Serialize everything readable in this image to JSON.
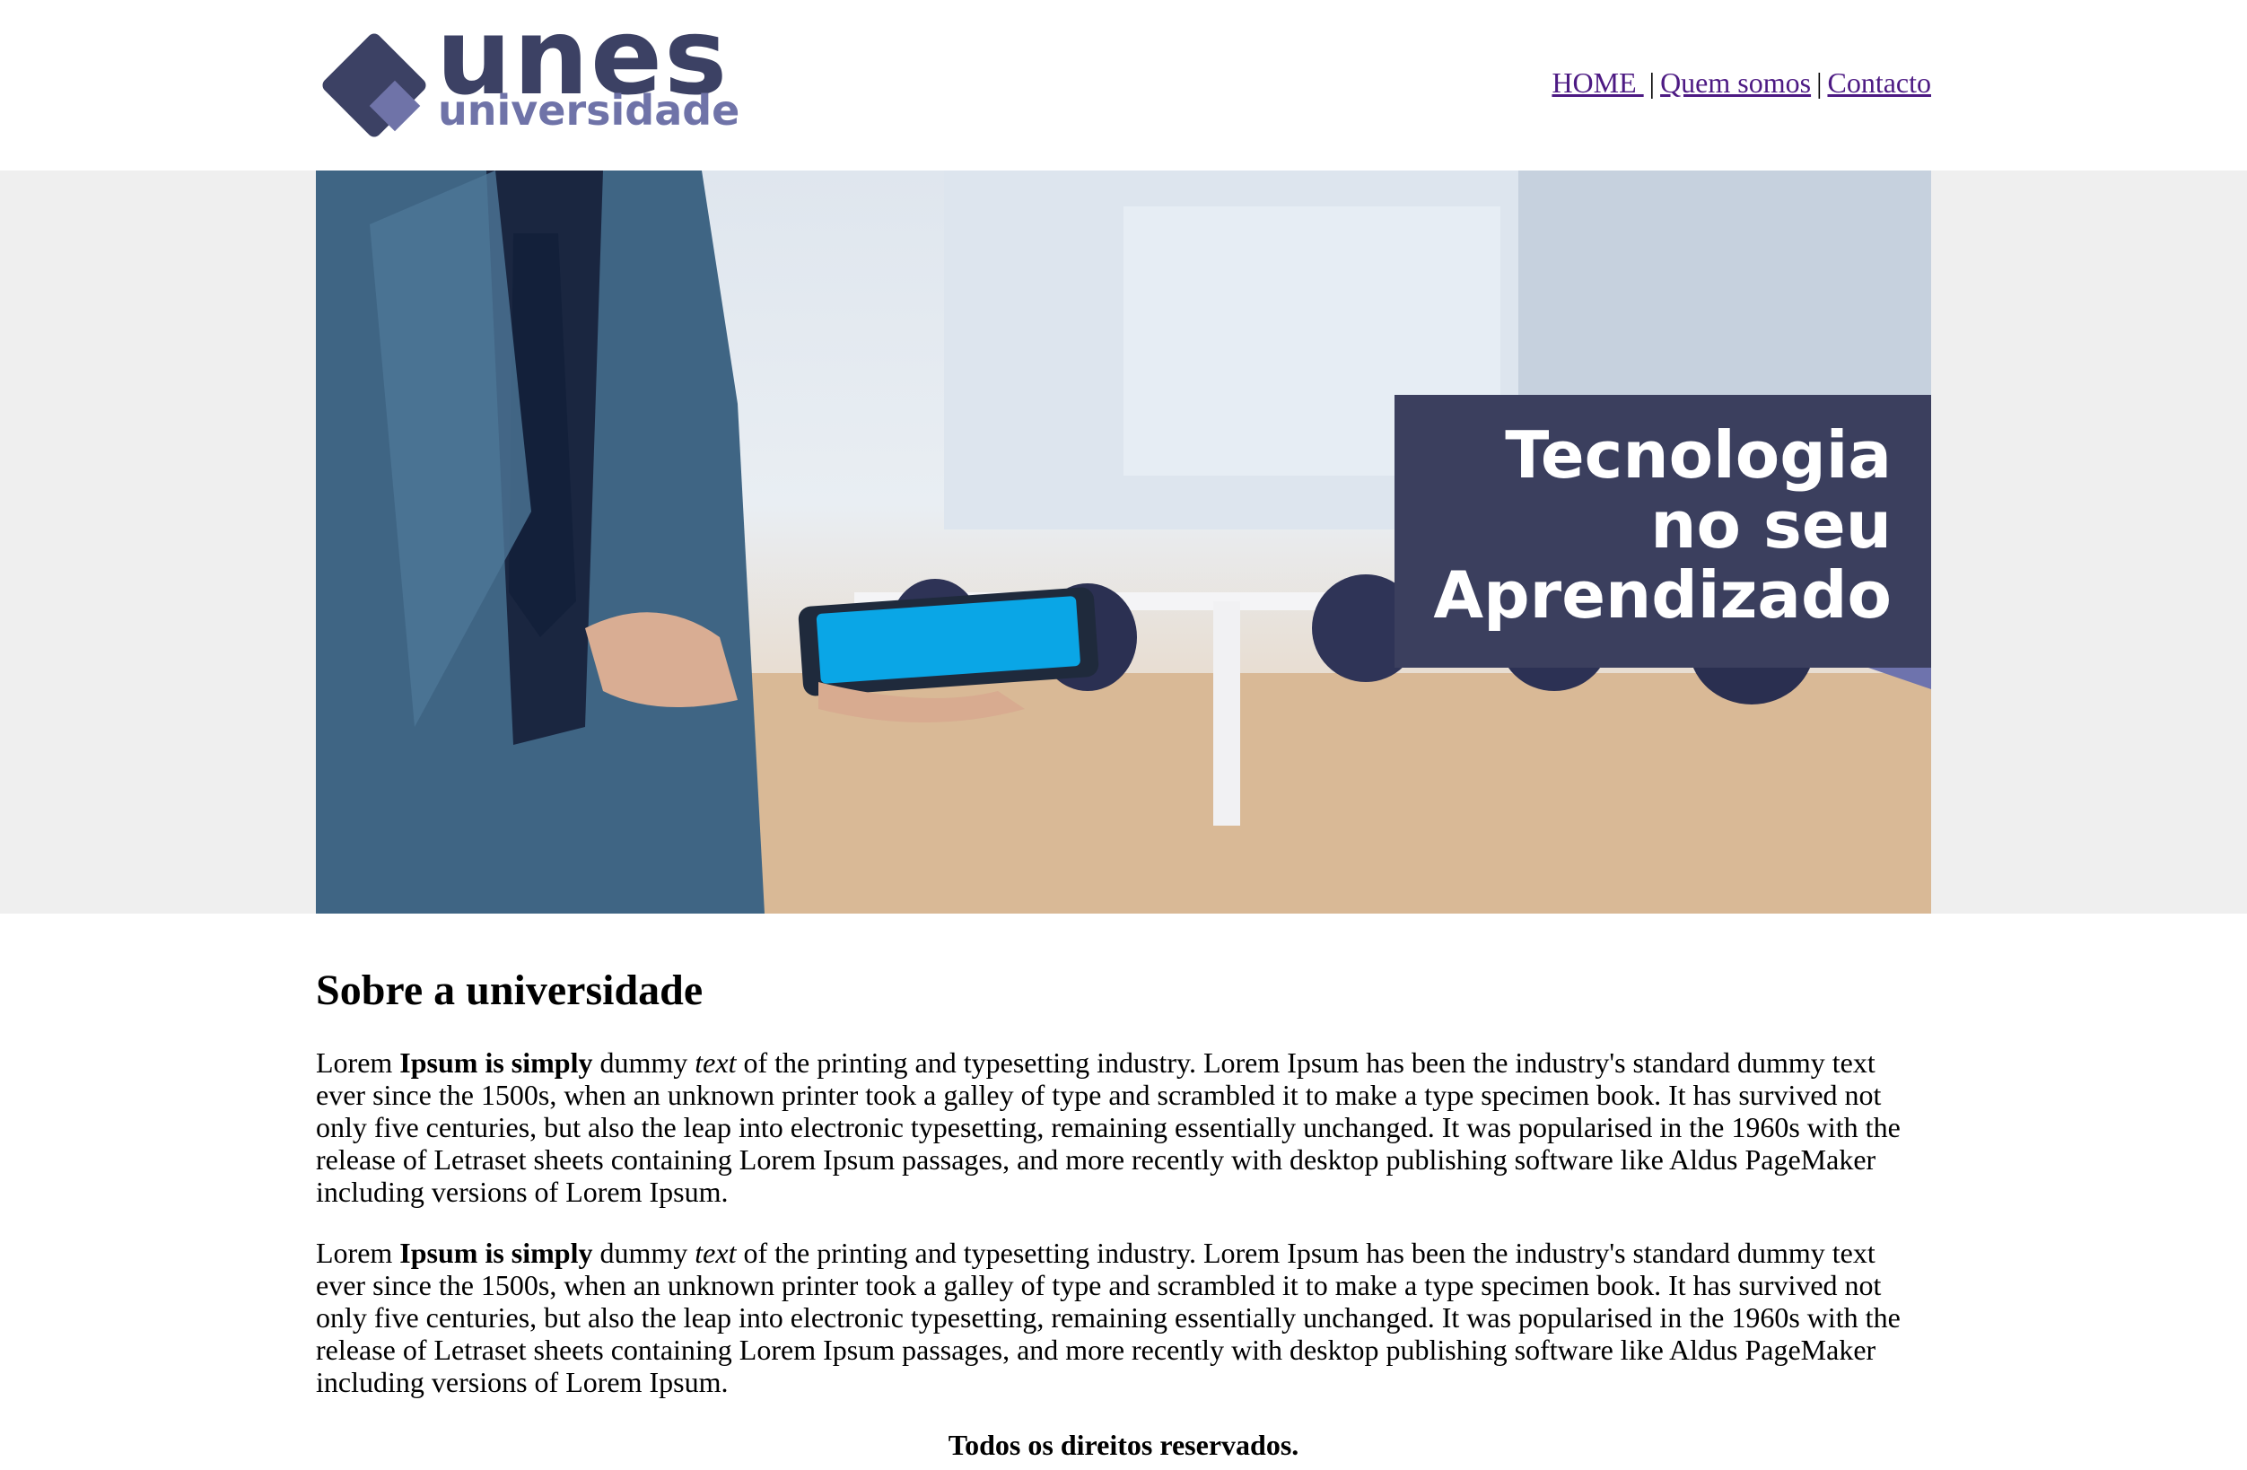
{
  "logo": {
    "main": "unes",
    "sub": "universidade",
    "colors": {
      "dark": "#3c4164",
      "light": "#6f73a8"
    }
  },
  "nav": {
    "items": [
      {
        "label": "HOME "
      },
      {
        "label": "Quem somos"
      },
      {
        "label": "Contacto"
      }
    ],
    "separator": "|",
    "link_color": "#4d1a83"
  },
  "banner": {
    "headline": [
      "Tecnologia",
      "no seu",
      "Aprendizado"
    ],
    "box_color": "#3b3f5e",
    "accent_color": "#6e73ad"
  },
  "main": {
    "title": "Sobre a universidade",
    "paragraphs": [
      {
        "lead": "Lorem ",
        "bold": "Ipsum is simply",
        "mid": " dummy ",
        "italic": "text",
        "rest": " of the printing and typesetting industry. Lorem Ipsum has been the industry's standard dummy text ever since the 1500s, when an unknown printer took a galley of type and scrambled it to make a type specimen book. It has survived not only five centuries, but also the leap into electronic typesetting, remaining essentially unchanged. It was popularised in the 1960s with the release of Letraset sheets containing Lorem Ipsum passages, and more recently with desktop publishing software like Aldus PageMaker including versions of Lorem Ipsum."
      },
      {
        "lead": "Lorem ",
        "bold": "Ipsum is simply",
        "mid": " dummy ",
        "italic": "text",
        "rest": " of the printing and typesetting industry. Lorem Ipsum has been the industry's standard dummy text ever since the 1500s, when an unknown printer took a galley of type and scrambled it to make a type specimen book. It has survived not only five centuries, but also the leap into electronic typesetting, remaining essentially unchanged. It was popularised in the 1960s with the release of Letraset sheets containing Lorem Ipsum passages, and more recently with desktop publishing software like Aldus PageMaker including versions of Lorem Ipsum."
      }
    ]
  },
  "footer": {
    "text": "Todos os direitos reservados."
  }
}
